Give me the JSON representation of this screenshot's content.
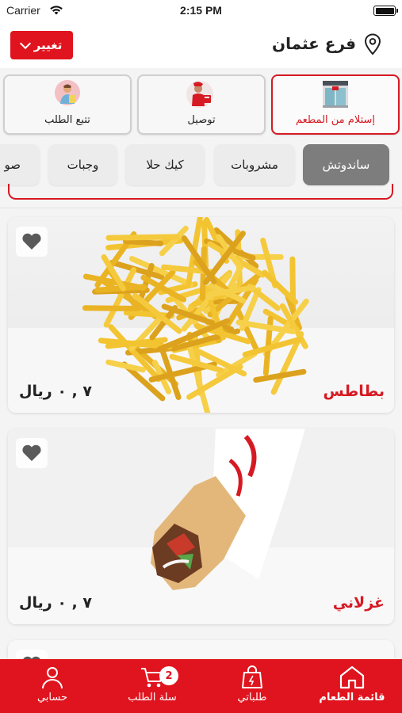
{
  "status_bar": {
    "carrier": "Carrier",
    "time": "2:15 PM"
  },
  "header": {
    "change_label": "تغيير",
    "branch_name": "فرع عثمان"
  },
  "order_types": [
    {
      "label": "إستلام من المطعم",
      "icon": "storefront-icon",
      "active": true
    },
    {
      "label": "توصيل",
      "icon": "delivery-icon",
      "active": false
    },
    {
      "label": "تتبع الطلب",
      "icon": "track-order-icon",
      "active": false
    }
  ],
  "categories": [
    {
      "label": "ساندوتش",
      "active": true
    },
    {
      "label": "مشروبات",
      "active": false
    },
    {
      "label": "كيك حلا",
      "active": false
    },
    {
      "label": "وجبات",
      "active": false
    },
    {
      "label": "صو",
      "active": false
    }
  ],
  "products": [
    {
      "name": "بطاطس",
      "price": "٧ , ٠ ريال",
      "image": "fries",
      "favorite_icon": "heart-icon"
    },
    {
      "name": "غزلاني",
      "price": "٧ , ٠ ريال",
      "image": "wrap",
      "favorite_icon": "heart-icon"
    }
  ],
  "bottom_nav": [
    {
      "label": "قائمة الطعام",
      "icon": "home-icon",
      "active": true
    },
    {
      "label": "طلباتي",
      "icon": "shopping-bag-icon",
      "active": false
    },
    {
      "label": "سلة الطلب",
      "icon": "cart-icon",
      "active": false,
      "badge": "2"
    },
    {
      "label": "حسابي",
      "icon": "user-icon",
      "active": false
    }
  ],
  "colors": {
    "brand_red": "#e0141e",
    "active_category": "#7d7d7d"
  }
}
